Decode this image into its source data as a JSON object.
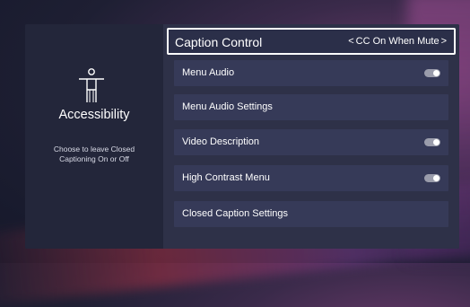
{
  "sidebar": {
    "icon": "accessibility-person-icon",
    "title": "Accessibility",
    "description": "Choose to leave Closed Captioning On or Off"
  },
  "caption_control": {
    "label": "Caption Control",
    "value": "CC On When Mute",
    "left_arrow": "<",
    "right_arrow": ">"
  },
  "menu": {
    "items": [
      {
        "label": "Menu Audio",
        "has_toggle": true,
        "toggle_on": false
      },
      {
        "label": "Menu Audio Settings",
        "has_toggle": false
      },
      {
        "label": "Video Description",
        "has_toggle": true,
        "toggle_on": false
      },
      {
        "label": "High Contrast Menu",
        "has_toggle": true,
        "toggle_on": false
      },
      {
        "label": "Closed Caption Settings",
        "has_toggle": false
      }
    ]
  },
  "colors": {
    "panel_left": "#23263a",
    "panel_right": "#2e3148",
    "row_bg": "#363a58",
    "focus_border": "#ffffff",
    "text": "#ffffff",
    "toggle_off": "#9a9cab"
  }
}
